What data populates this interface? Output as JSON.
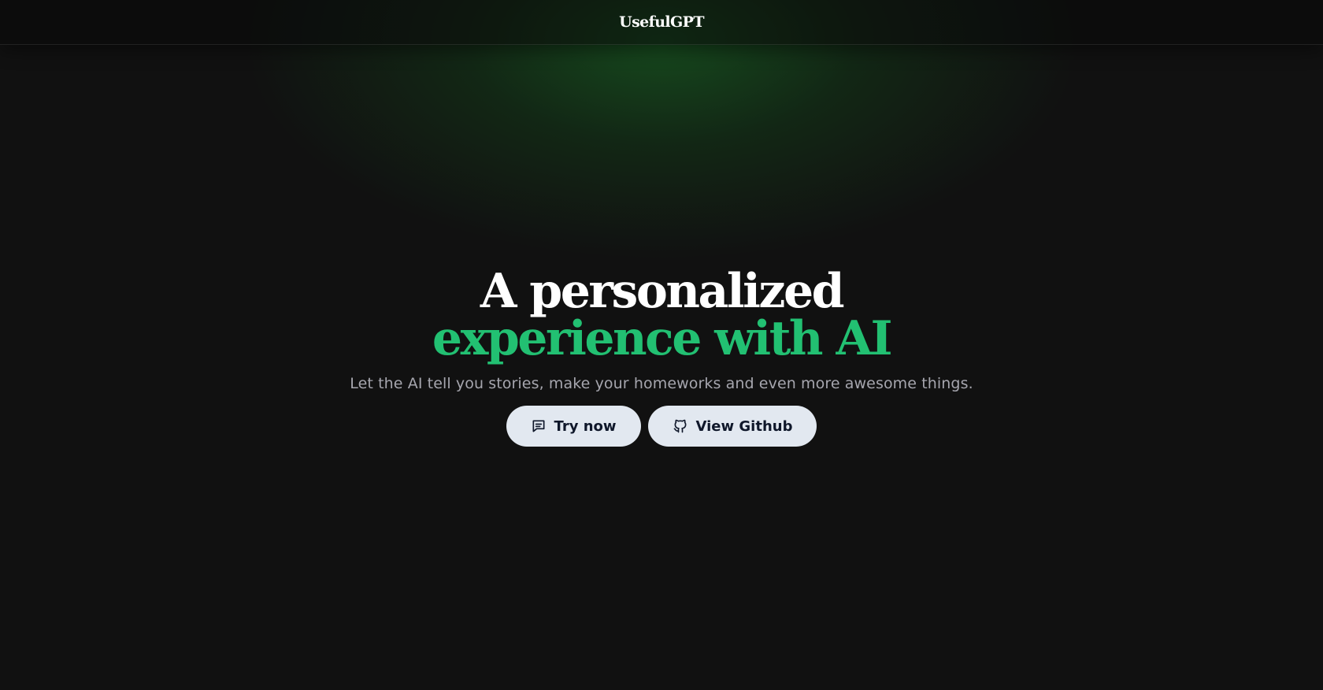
{
  "header": {
    "brand": "UsefulGPT"
  },
  "hero": {
    "title_line1": "A personalized",
    "title_line2": "experience with AI",
    "subtitle": "Let the AI tell you stories, make your homeworks and even more awesome things."
  },
  "buttons": {
    "try_now": {
      "label": "Try now",
      "icon": "chat-icon"
    },
    "github": {
      "label": "View Github",
      "icon": "github-icon"
    }
  },
  "colors": {
    "background": "#111111",
    "accent_green": "#22c072",
    "button_bg": "#e2e8f0",
    "button_text": "#0f172a",
    "subtitle_text": "#a6a6ae"
  }
}
